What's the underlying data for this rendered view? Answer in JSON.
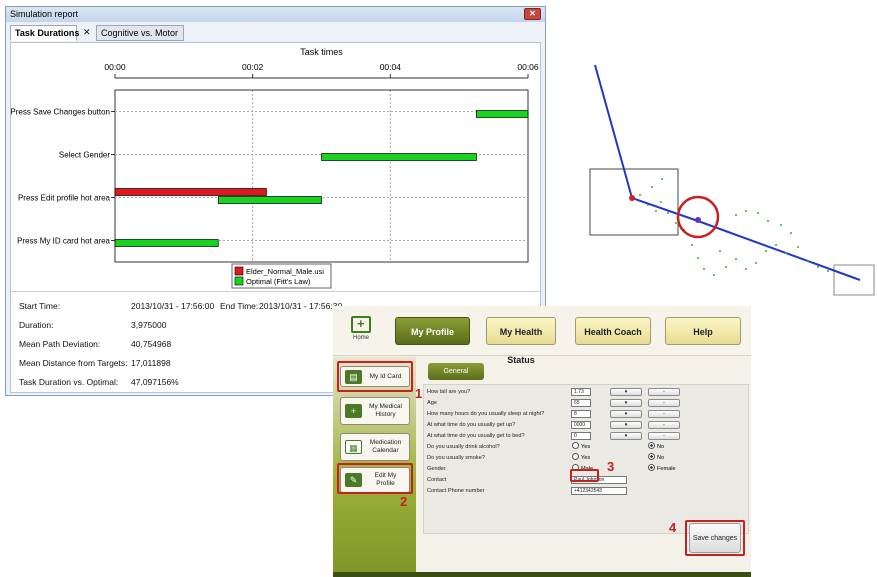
{
  "report": {
    "title": "Simulation report",
    "close_glyph": "✕",
    "tabs": [
      {
        "label": "Task Durations",
        "active": true
      },
      {
        "label": "Cognitive vs. Motor",
        "active": false
      }
    ],
    "tab_close_glyph": "✕",
    "stats": {
      "start_time_label": "Start Time:",
      "start_time_value": "2013/10/31 - 17:56:00",
      "end_time_label": "End Time:",
      "end_time_value": "2013/10/31 - 17:56:30",
      "duration_label": "Duration:",
      "duration_value": "3,975000",
      "path_dev_label": "Mean Path Deviation:",
      "path_dev_value": "40,754968",
      "mean_dist_label": "Mean Distance from Targets:",
      "mean_dist_value": "17,011898",
      "task_vs_opt_label": "Task Duration vs. Optimal:",
      "task_vs_opt_value": "47,097156%"
    }
  },
  "chart_data": {
    "type": "bar",
    "orientation": "horizontal-gantt",
    "title": "Task times",
    "x_ticks": [
      "00:00",
      "00:02",
      "00:04",
      "00:06"
    ],
    "xlim_seconds": [
      0,
      6
    ],
    "categories": [
      "Press Save Changes button",
      "Select Gender",
      "Press Edit profile hot area",
      "Press My ID card hot area"
    ],
    "series": [
      {
        "name": "Elder_Normal_Male.usi",
        "color": "#e0191f",
        "bars": [
          {
            "category": "Press Edit profile hot area",
            "start": 0.0,
            "end": 2.2
          }
        ]
      },
      {
        "name": "Optimal (Fitt's Law)",
        "color": "#19d41e",
        "bars": [
          {
            "category": "Press Save Changes button",
            "start": 5.25,
            "end": 6.0
          },
          {
            "category": "Select Gender",
            "start": 3.0,
            "end": 5.25
          },
          {
            "category": "Press Edit profile hot area",
            "start": 1.5,
            "end": 3.0
          },
          {
            "category": "Press My ID card hot area",
            "start": 0.0,
            "end": 1.5
          }
        ]
      }
    ],
    "grid": true,
    "legend_placement": "bottom-center"
  },
  "app": {
    "home_label": "Home",
    "nav": [
      {
        "label": "My Profile",
        "active": true
      },
      {
        "label": "My Health Status",
        "active": false
      },
      {
        "label": "Health Coach",
        "active": false
      },
      {
        "label": "Help",
        "active": false
      }
    ],
    "sidebar": [
      {
        "label": "My Id Card",
        "icon": "id-card-icon"
      },
      {
        "label": "My Medical History",
        "icon": "medical-kit-icon"
      },
      {
        "label": "Medication Calendar",
        "icon": "calendar-icon"
      },
      {
        "label": "Edit My Profile",
        "icon": "edit-profile-icon"
      }
    ],
    "general_tab": "General",
    "form": {
      "height_q": "How tall are you?",
      "height_v": "1.73",
      "age_q": "Age",
      "age_v": "65",
      "sleep_q": "How many hours do you usually sleep at night?",
      "sleep_v": "8",
      "getup_q": "At what time do you usually get up?",
      "getup_v": "0000",
      "bed_q": "At what time do you usually get to bed?",
      "bed_v": "0",
      "alcohol_q": "Do you usually drink alcohol?",
      "smoke_q": "Do you usually smoke?",
      "gender_q": "Gender",
      "contact_q": "Contact",
      "contact_v": "Paul Johnson",
      "phone_q": "Contact Phone number",
      "phone_v": "+412342543",
      "yes": "Yes",
      "no": "No",
      "male": "Male",
      "female": "Female"
    },
    "save_label": "Save changes",
    "markers": [
      "1",
      "2",
      "3",
      "4"
    ]
  }
}
